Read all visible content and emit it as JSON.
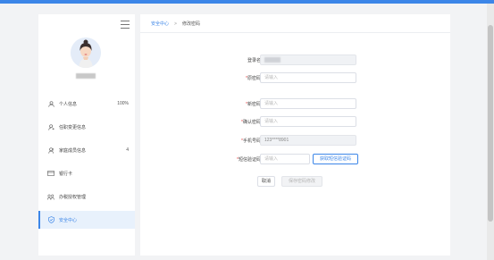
{
  "sidebar": {
    "items": [
      {
        "label": "个人信息",
        "icon": "user-icon",
        "count": "100%"
      },
      {
        "label": "任职变更信息",
        "icon": "user-change-icon",
        "count": ""
      },
      {
        "label": "家庭成员信息",
        "icon": "family-icon",
        "count": "4"
      },
      {
        "label": "银行卡",
        "icon": "bank-card-icon",
        "count": ""
      },
      {
        "label": "办税授权管理",
        "icon": "authorization-icon",
        "count": ""
      },
      {
        "label": "安全中心",
        "icon": "shield-icon",
        "count": "",
        "active": true
      }
    ]
  },
  "breadcrumb": {
    "parent": "安全中心",
    "separator": ">",
    "current": "修改密码"
  },
  "form": {
    "login_name_label": "登录名",
    "old_password_label": "原密码",
    "old_password_placeholder": "请输入",
    "new_password_label": "新密码",
    "new_password_placeholder": "请输入",
    "confirm_password_label": "确认密码",
    "confirm_password_placeholder": "请输入",
    "phone_label": "手机号码",
    "phone_value": "123****8901",
    "sms_label": "短信验证码",
    "sms_placeholder": "请输入",
    "sms_button": "获取短信验证码",
    "required_mark": "*"
  },
  "actions": {
    "cancel": "取消",
    "save": "保存密码修改"
  },
  "colors": {
    "accent": "#3c86e8",
    "required": "#e64545",
    "background": "#f2f3f5"
  }
}
